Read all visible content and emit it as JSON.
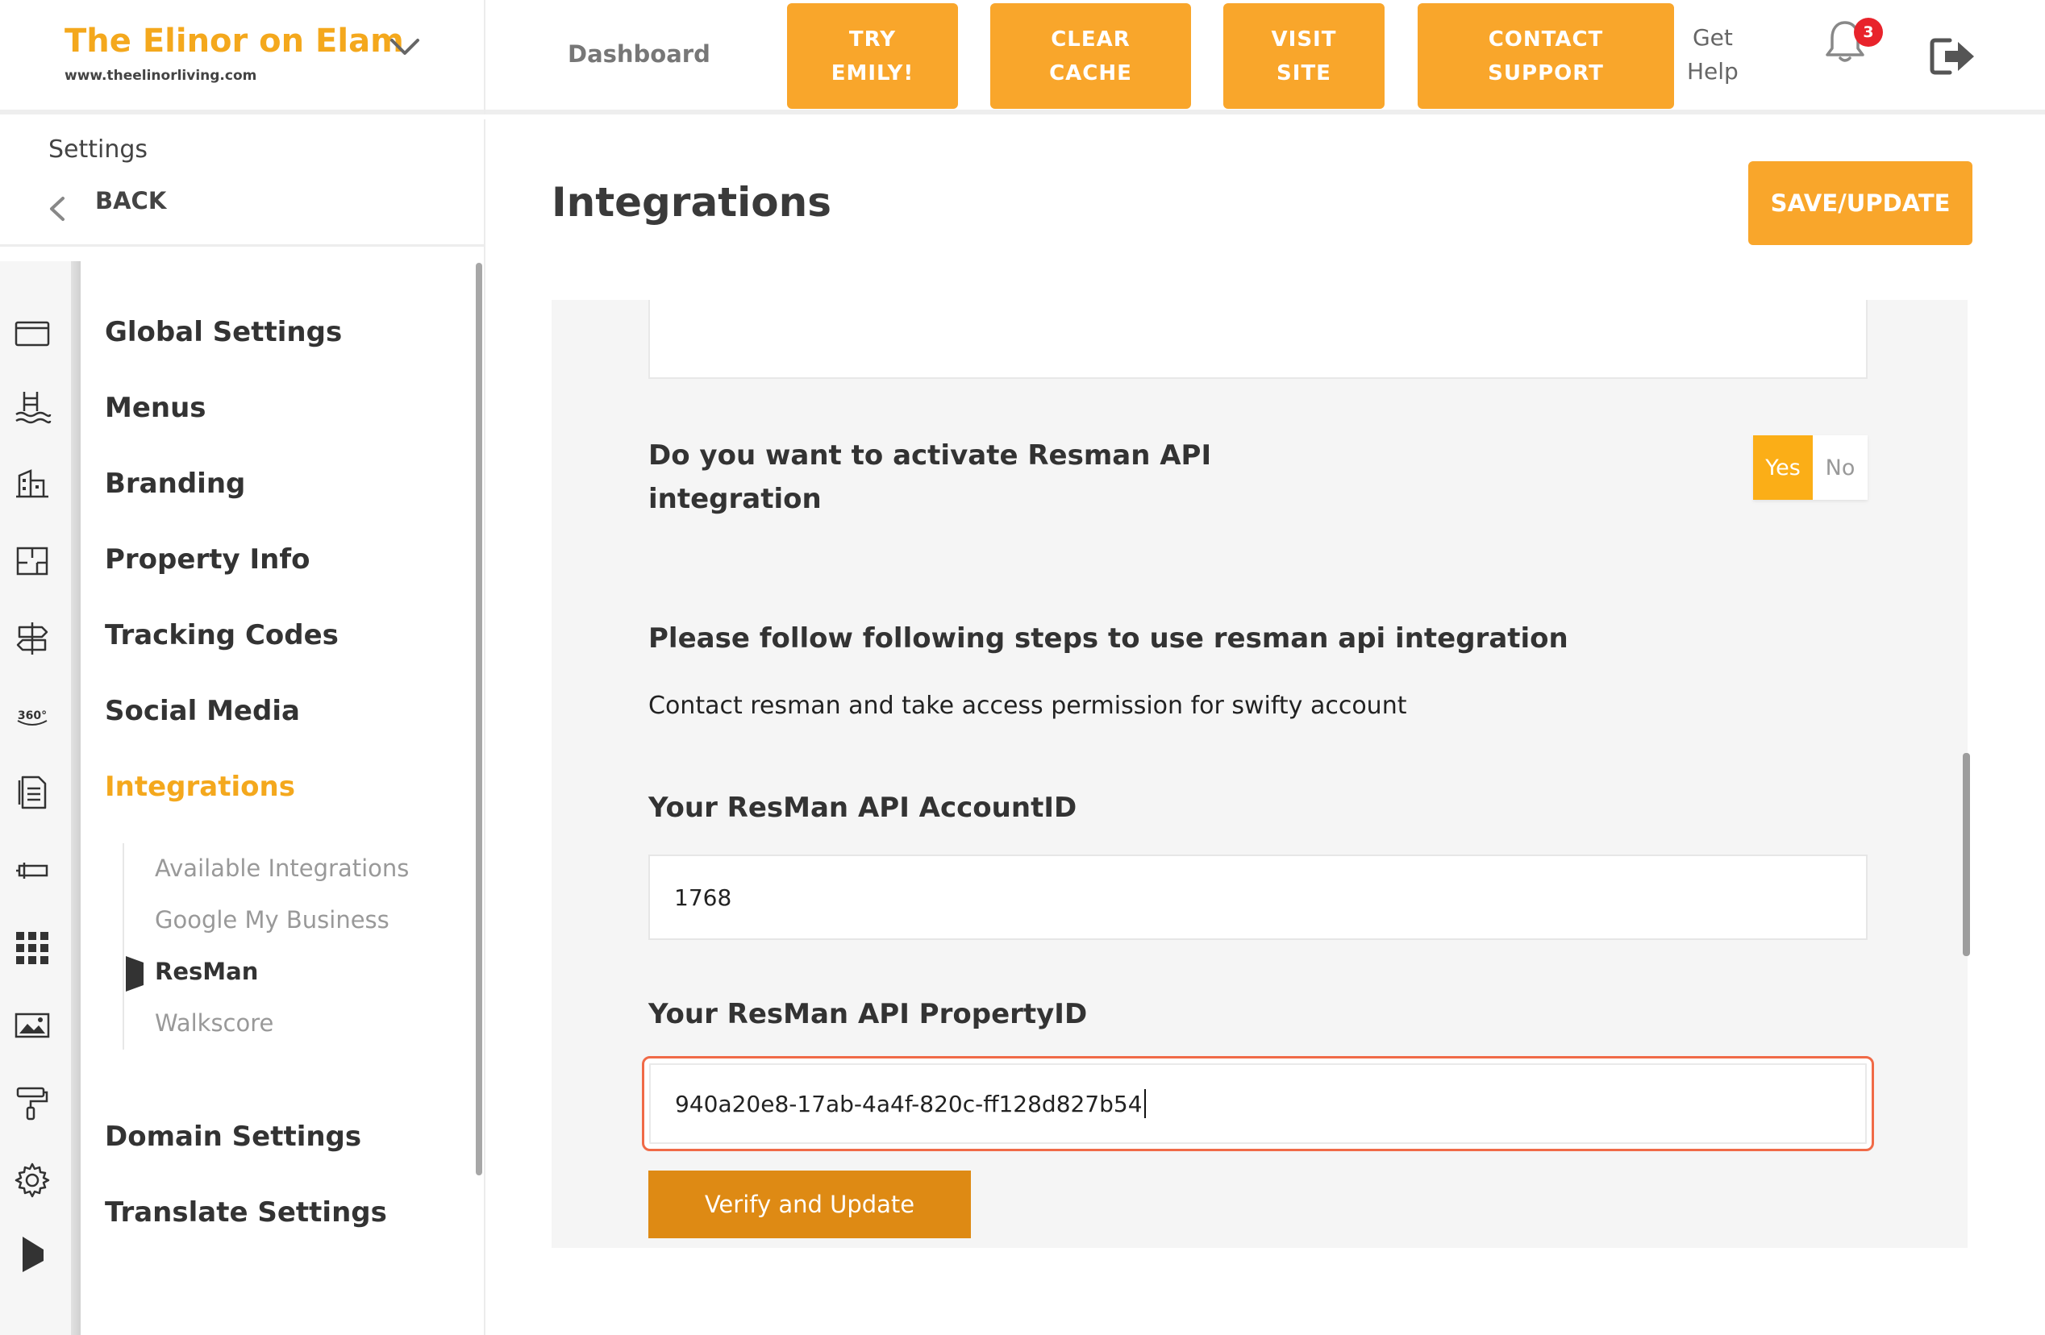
{
  "header": {
    "brand_name": "The Elinor on Elam",
    "brand_url": "www.theelinorliving.com",
    "nav_dashboard": "Dashboard",
    "buttons": {
      "try": [
        "TRY",
        "EMILY!"
      ],
      "clear": [
        "CLEAR",
        "CACHE"
      ],
      "visit": [
        "VISIT",
        "SITE"
      ],
      "contact": [
        "CONTACT",
        "SUPPORT"
      ]
    },
    "get_help": [
      "Get",
      "Help"
    ],
    "notification_count": "3"
  },
  "sidebar": {
    "title": "Settings",
    "back_label": "BACK",
    "menu": [
      {
        "label": "Global Settings"
      },
      {
        "label": "Menus"
      },
      {
        "label": "Branding"
      },
      {
        "label": "Property Info"
      },
      {
        "label": "Tracking Codes"
      },
      {
        "label": "Social Media"
      },
      {
        "label": "Integrations",
        "active": true
      },
      {
        "label": "Domain Settings"
      },
      {
        "label": "Translate Settings"
      }
    ],
    "submenu": [
      {
        "label": "Available Integrations"
      },
      {
        "label": "Google My Business"
      },
      {
        "label": "ResMan",
        "current": true
      },
      {
        "label": "Walkscore"
      }
    ],
    "rail_icons": [
      "browser-window-icon",
      "pool-icon",
      "building-icon",
      "floorplan-icon",
      "signpost-icon",
      "360-view-icon",
      "document-icon",
      "pen-tool-icon",
      "grid-apps-icon",
      "image-icon",
      "paint-roller-icon",
      "gear-icon",
      "flag-icon"
    ]
  },
  "main": {
    "page_title": "Integrations",
    "save_label": "SAVE/UPDATE",
    "question": "Do you want to activate Resman API integration",
    "toggle": {
      "yes": "Yes",
      "no": "No",
      "selected": "Yes"
    },
    "steps_title": "Please follow following steps to use resman api integration",
    "steps_text": "Contact resman and take access permission for swifty account",
    "account_label": "Your ResMan API AccountID",
    "account_value": "1768",
    "property_label": "Your ResMan API PropertyID",
    "property_value": "940a20e8-17ab-4a4f-820c-ff128d827b54",
    "verify_label": "Verify and Update"
  },
  "colors": {
    "accent": "#f9a62b",
    "brand": "#f4a81d",
    "verify": "#de8a14",
    "focus_border": "#f06a47",
    "badge": "#e8232b"
  }
}
